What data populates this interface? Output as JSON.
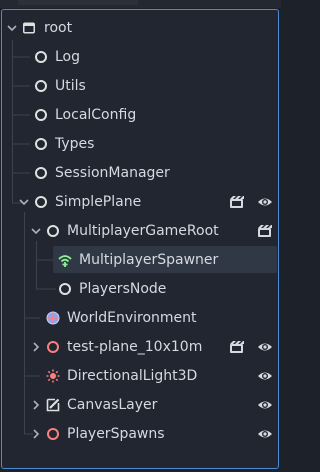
{
  "tree": {
    "root": "root",
    "nodes": [
      {
        "label": "Log",
        "icon": "node-circle-icon"
      },
      {
        "label": "Utils",
        "icon": "node-circle-icon"
      },
      {
        "label": "LocalConfig",
        "icon": "node-circle-icon"
      },
      {
        "label": "Types",
        "icon": "node-circle-icon"
      },
      {
        "label": "SessionManager",
        "icon": "node-circle-icon"
      },
      {
        "label": "SimplePlane",
        "icon": "node-circle-icon",
        "expanded": true
      },
      {
        "label": "MultiplayerGameRoot",
        "icon": "node-circle-icon",
        "expanded": true
      },
      {
        "label": "MultiplayerSpawner",
        "icon": "multiplayer-spawner-icon",
        "selected": true
      },
      {
        "label": "PlayersNode",
        "icon": "node-circle-icon"
      },
      {
        "label": "WorldEnvironment",
        "icon": "world-environment-icon"
      },
      {
        "label": "test-plane_10x10m",
        "icon": "node3d-circle-icon",
        "collapsed": true
      },
      {
        "label": "DirectionalLight3D",
        "icon": "directional-light-icon"
      },
      {
        "label": "CanvasLayer",
        "icon": "canvas-layer-icon",
        "collapsed": true
      },
      {
        "label": "PlayerSpawns",
        "icon": "node3d-circle-icon",
        "collapsed": true
      }
    ]
  },
  "colors": {
    "background": "#212630",
    "selection": "#313845",
    "focus_border": "#4a8ad6",
    "node_white": "#e0e0e0",
    "node3d_red": "#fc7f7f",
    "spawner_green": "#8eef97",
    "world_blue": "#8da5f3"
  }
}
